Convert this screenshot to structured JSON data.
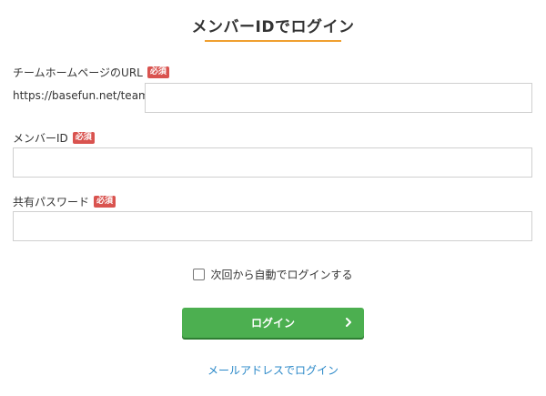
{
  "title": "メンバーIDでログイン",
  "required_badge": "必須",
  "colors": {
    "accent_underline": "#f0a030",
    "required": "#d9534f",
    "primary_button": "#4caf50",
    "link": "#2a88c8"
  },
  "fields": {
    "team_url": {
      "label": "チームホームページのURL",
      "prefix": "https://basefun.net/team/",
      "value": "",
      "placeholder": ""
    },
    "member_id": {
      "label": "メンバーID",
      "value": "",
      "placeholder": ""
    },
    "password": {
      "label": "共有パスワード",
      "value": "",
      "placeholder": ""
    }
  },
  "auto_login": {
    "label": "次回から自動でログインする",
    "checked": false
  },
  "login_button": {
    "label": "ログイン",
    "icon": "chevron-right-icon"
  },
  "email_login_link": "メールアドレスでログイン"
}
